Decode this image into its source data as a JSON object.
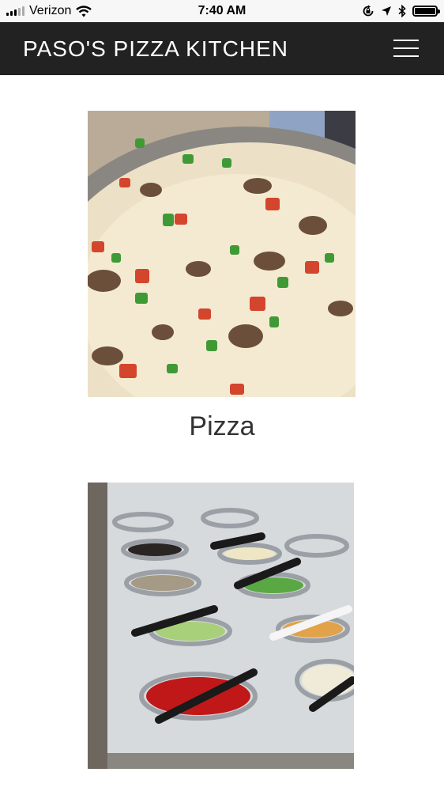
{
  "status_bar": {
    "carrier": "Verizon",
    "time": "7:40 AM",
    "icons": [
      "signal-icon",
      "wifi-icon",
      "rotation-lock-icon",
      "location-icon",
      "bluetooth-icon",
      "battery-icon"
    ]
  },
  "header": {
    "brand": "PASO'S PIZZA KITCHEN",
    "menu_icon": "hamburger-menu-icon",
    "background": "#222222"
  },
  "menu_items": [
    {
      "label": "Pizza",
      "image": "pizza-photo"
    },
    {
      "label": "",
      "image": "salad-bar-photo"
    }
  ]
}
